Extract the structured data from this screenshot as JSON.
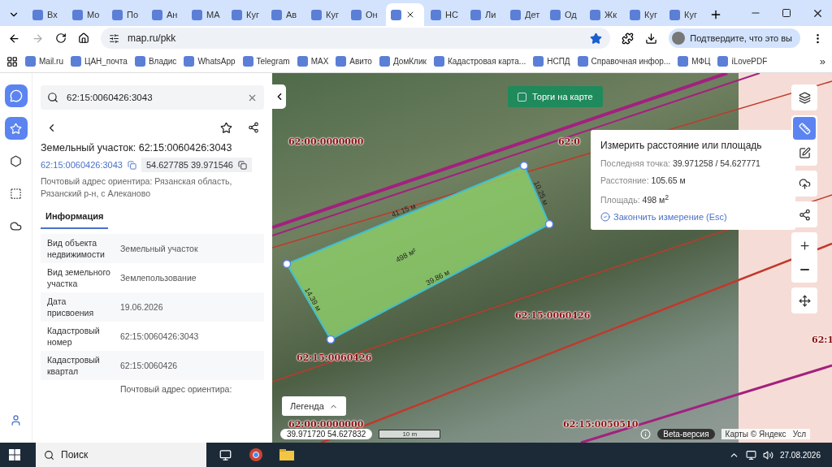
{
  "browser": {
    "tabs": [
      {
        "label": "Вх",
        "selected": false
      },
      {
        "label": "Мо",
        "selected": false
      },
      {
        "label": "По",
        "selected": false
      },
      {
        "label": "Ан",
        "selected": false
      },
      {
        "label": "МА",
        "selected": false
      },
      {
        "label": "Куг",
        "selected": false
      },
      {
        "label": "Ав",
        "selected": false
      },
      {
        "label": "Куг",
        "selected": false
      },
      {
        "label": "Он",
        "selected": false
      },
      {
        "selected": true
      },
      {
        "label": "НС",
        "selected": false
      },
      {
        "label": "Ли",
        "selected": false
      },
      {
        "label": "Дет",
        "selected": false
      },
      {
        "label": "Од",
        "selected": false
      },
      {
        "label": "Жк",
        "selected": false
      },
      {
        "label": "Куг",
        "selected": false
      },
      {
        "label": "Куг",
        "selected": false
      }
    ],
    "url": "map.ru/pkk",
    "bookmarked": true,
    "profile_prompt": "Подтвердите, что это вы",
    "bookmarks": [
      "Mail.ru",
      "ЦАН_почта",
      "Владис",
      "WhatsApp",
      "Telegram",
      "MAX",
      "Авито",
      "ДомКлик",
      "Кадастровая карта...",
      "НСПД",
      "Справочная инфор...",
      "МФЦ",
      "iLovePDF"
    ],
    "more_bookmarks": "»"
  },
  "rail": {
    "items": [
      {
        "kind": "favorites",
        "selected": true
      },
      {
        "kind": "polygon",
        "selected": false
      },
      {
        "kind": "selection",
        "selected": false
      },
      {
        "kind": "cloud",
        "selected": false
      }
    ]
  },
  "panel": {
    "search": "62:15:0060426:3043",
    "title": "Земельный участок: 62:15:0060426:3043",
    "cadastral_link": "62:15:0060426:3043",
    "coordinates": "54.627785 39.971546",
    "address": "Почтовый адрес ориентира: Рязанская область, Рязанский р-н, с Алеканово",
    "tabs": [
      {
        "label": "Информация",
        "selected": true
      }
    ],
    "rows": [
      {
        "key": "Вид объекта недвижимости",
        "value": "Земельный участок"
      },
      {
        "key": "Вид земельного участка",
        "value": "Землепользование"
      },
      {
        "key": "Дата присвоения",
        "value": "19.06.2026"
      },
      {
        "key": "Кадастровый номер",
        "value": "62:15:0060426:3043"
      },
      {
        "key": "Кадастровый квартал",
        "value": "62:15:0060426"
      },
      {
        "key": "",
        "value": "Почтовый адрес ориентира:"
      }
    ]
  },
  "map": {
    "auctions": {
      "label": "Торги на карте",
      "checked": false
    },
    "labels": [
      "62:00:0000000",
      "62:0",
      "62:15:0060426",
      "62:15:0060426",
      "62:00:0000000",
      "62:15:0050510",
      "62:1"
    ],
    "edges": [
      "41.15 м",
      "10.25 м",
      "39.86 м",
      "14.39 м"
    ],
    "area_label": "498 м²",
    "measure": {
      "title": "Измерить расстояние или площадь",
      "last_point_label": "Последняя точка:",
      "last_point": "39.971258 / 54.627771",
      "distance_label": "Расстояние:",
      "distance": "105.65 м",
      "area_label": "Площадь:",
      "area": "498 м$^{2}$",
      "finish": "Закончить измерение (Esc)"
    },
    "tools": [
      {
        "kind": "layers",
        "selected": false
      },
      {
        "kind": "ruler",
        "selected": true
      },
      {
        "kind": "edit",
        "selected": false
      },
      {
        "kind": "upload",
        "selected": false
      },
      {
        "kind": "share",
        "selected": false
      },
      {
        "kind": "zoom-in",
        "selected": false
      },
      {
        "kind": "zoom-out",
        "selected": false
      },
      {
        "kind": "move",
        "selected": false
      }
    ],
    "legend": "Легенда",
    "cursor": "39.971720 54.627832",
    "scale": "10 m",
    "beta": "Beta-версия",
    "copyright": "Карты © Яндекс",
    "terms": "Усл"
  },
  "taskbar": {
    "search": "Поиск",
    "date": "27.08.2026"
  }
}
